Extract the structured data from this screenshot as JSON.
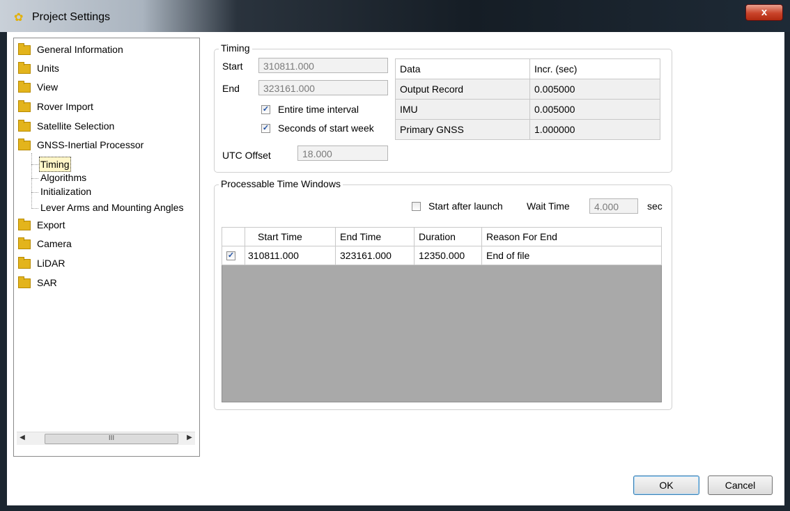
{
  "window": {
    "title": "Project Settings",
    "close_label": "x"
  },
  "tree": {
    "items": [
      {
        "label": "General Information"
      },
      {
        "label": "Units"
      },
      {
        "label": "View"
      },
      {
        "label": "Rover Import"
      },
      {
        "label": "Satellite Selection"
      },
      {
        "label": "GNSS-Inertial Processor"
      },
      {
        "label": "Export"
      },
      {
        "label": "Camera"
      },
      {
        "label": "LiDAR"
      },
      {
        "label": "SAR"
      }
    ],
    "children": [
      {
        "label": "Timing"
      },
      {
        "label": "Algorithms"
      },
      {
        "label": "Initialization"
      },
      {
        "label": "Lever Arms and Mounting Angles"
      }
    ],
    "scroll_thumb_label": "III"
  },
  "timing": {
    "group_label": "Timing",
    "start_label": "Start",
    "start_value": "310811.000",
    "end_label": "End",
    "end_value": "323161.000",
    "entire_interval_label": "Entire time interval",
    "entire_interval_checked": true,
    "seconds_week_label": "Seconds of start week",
    "seconds_week_checked": true,
    "utc_label": "UTC Offset",
    "utc_value": "18.000",
    "data_table": {
      "headers": [
        "Data",
        "Incr. (sec)"
      ],
      "rows": [
        [
          "Output Record",
          "0.005000"
        ],
        [
          "IMU",
          "0.005000"
        ],
        [
          "Primary GNSS",
          "1.000000"
        ]
      ]
    }
  },
  "windows": {
    "group_label": "Processable Time Windows",
    "start_after_launch_label": "Start after launch",
    "start_after_launch_checked": false,
    "wait_time_label": "Wait Time",
    "wait_time_value": "4.000",
    "wait_unit": "sec",
    "headers": [
      "Start Time",
      "End Time",
      "Duration",
      "Reason For End"
    ],
    "rows": [
      {
        "checked": true,
        "start": "310811.000",
        "end": "323161.000",
        "duration": "12350.000",
        "reason": "End of file"
      }
    ]
  },
  "buttons": {
    "ok": "OK",
    "cancel": "Cancel"
  },
  "colors": {
    "title_accent": "#e3b000",
    "close_red": "#c9432a",
    "grid_empty": "#a9a9a9"
  }
}
